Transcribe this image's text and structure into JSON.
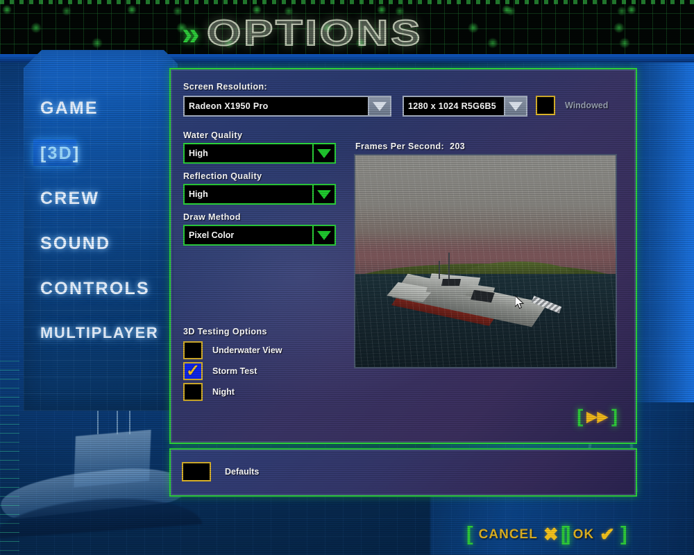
{
  "header": {
    "chevron_icon": "double-chevron-right",
    "title": "OPTIONS"
  },
  "sidebar": {
    "items": [
      {
        "label": "GAME",
        "selected": false
      },
      {
        "label": "3D",
        "selected": true,
        "bracket_left": "[",
        "bracket_right": "]"
      },
      {
        "label": "CREW",
        "selected": false
      },
      {
        "label": "SOUND",
        "selected": false
      },
      {
        "label": "CONTROLS",
        "selected": false
      },
      {
        "label": "MULTIPLAYER",
        "selected": false
      }
    ]
  },
  "panel": {
    "screen_resolution_label": "Screen Resolution:",
    "adapter": {
      "value": "Radeon X1950 Pro",
      "arrow_icon": "chevron-down-icon"
    },
    "resolution": {
      "value": "1280 x 1024 R5G6B5",
      "arrow_icon": "chevron-down-icon"
    },
    "windowed": {
      "label": "Windowed",
      "checked": false
    },
    "water_quality": {
      "label": "Water Quality",
      "value": "High",
      "arrow_icon": "chevron-down-icon"
    },
    "reflection_quality": {
      "label": "Reflection Quality",
      "value": "High",
      "arrow_icon": "chevron-down-icon"
    },
    "draw_method": {
      "label": "Draw Method",
      "value": "Pixel Color",
      "arrow_icon": "chevron-down-icon"
    },
    "fps": {
      "label": "Frames Per Second:",
      "value": "203"
    },
    "testing_options": {
      "title": "3D Testing Options",
      "items": [
        {
          "label": "Underwater View",
          "checked": false
        },
        {
          "label": "Storm Test",
          "checked": true,
          "tick_icon": "checkmark-icon"
        },
        {
          "label": "Night",
          "checked": false
        }
      ]
    },
    "forward_button": {
      "bracket_left": "[",
      "icon": "fast-forward-icon",
      "glyph": "▶▶",
      "bracket_right": "]"
    }
  },
  "defaults_panel": {
    "label": "Defaults",
    "checked": false
  },
  "footer": {
    "cancel": {
      "label": "CANCEL",
      "mark": "✖",
      "mark_icon": "x-icon",
      "bracket_left": "[",
      "bracket_right": "]"
    },
    "ok": {
      "label": "OK",
      "mark": "✔",
      "mark_icon": "checkmark-icon",
      "bracket_left": "[",
      "bracket_right": "]"
    }
  },
  "colors": {
    "green_border": "#2bd23a",
    "gold": "#d9b22a",
    "checked_blue": "#1026e8",
    "panel_start": "#2d3f78",
    "panel_end": "#2b2450"
  }
}
